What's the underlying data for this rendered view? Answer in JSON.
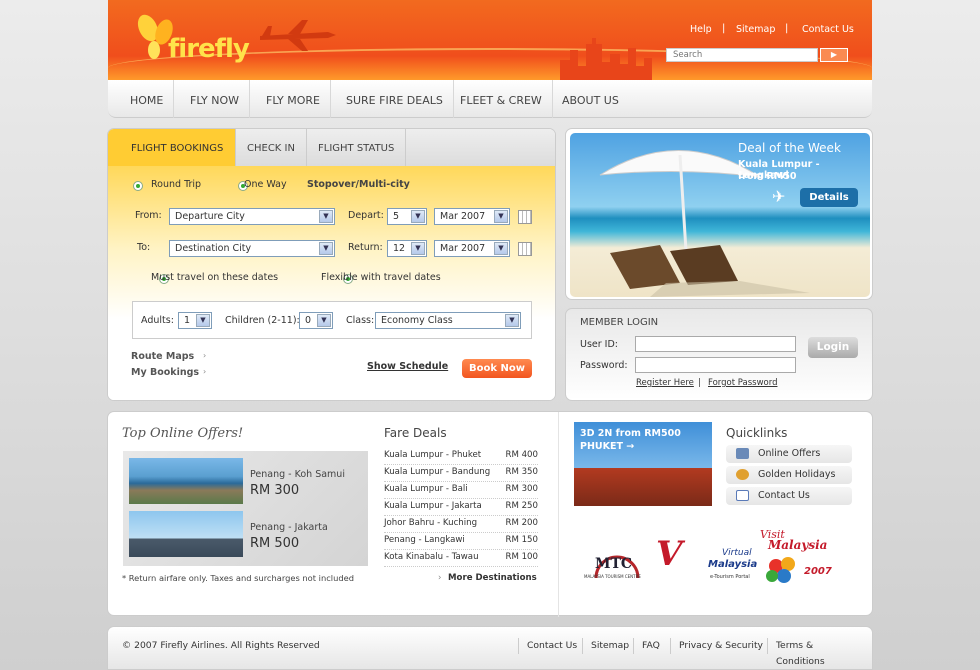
{
  "brand": {
    "name": "firefly"
  },
  "top_links": {
    "help": "Help",
    "sitemap": "Sitemap",
    "contact": "Contact Us"
  },
  "search": {
    "placeholder": "Search"
  },
  "nav": {
    "home": "HOME",
    "fly_now": "FLY NOW",
    "fly_more": "FLY MORE",
    "sure_fire": "SURE FIRE DEALS",
    "fleet": "FLEET & CREW",
    "about": "ABOUT US"
  },
  "booking": {
    "tabs": {
      "bookings": "FLIGHT BOOKINGS",
      "checkin": "CHECK IN",
      "status": "FLIGHT STATUS"
    },
    "trip": {
      "round": "Round Trip",
      "oneway": "One Way",
      "multi": "Stopover/Multi-city"
    },
    "from_label": "From:",
    "from_value": "Departure City",
    "to_label": "To:",
    "to_value": "Destination City",
    "depart_label": "Depart:",
    "depart_day": "5",
    "depart_month": "Mar 2007",
    "return_label": "Return:",
    "return_day": "12",
    "return_month": "Mar 2007",
    "must_travel": "Must travel on these dates",
    "flexible": "Flexible with travel dates",
    "adults_label": "Adults:",
    "adults_value": "1",
    "children_label": "Children (2-11):",
    "children_value": "0",
    "class_label": "Class:",
    "class_value": "Economy Class",
    "route_maps": "Route Maps",
    "my_bookings": "My Bookings",
    "show_schedule": "Show Schedule",
    "book_now": "Book Now"
  },
  "deal": {
    "title": "Deal of the Week",
    "route": "Kuala Lumpur - Langkawi",
    "price": "from RM50",
    "details": "Details"
  },
  "member": {
    "title": "MEMBER LOGIN",
    "userid": "User ID:",
    "password": "Password:",
    "login": "Login",
    "register": "Register Here",
    "sep": "|",
    "forgot": "Forgot Password"
  },
  "offers": {
    "title": "Top Online Offers!",
    "items": [
      {
        "route": "Penang - Koh Samui",
        "price": "RM 300"
      },
      {
        "route": "Penang - Jakarta",
        "price": "RM 500"
      }
    ],
    "note": "* Return airfare only. Taxes and surcharges not included"
  },
  "fares": {
    "title": "Fare Deals",
    "rows": [
      {
        "route": "Kuala Lumpur - Phuket",
        "price": "RM 400"
      },
      {
        "route": "Kuala Lumpur - Bandung",
        "price": "RM 350"
      },
      {
        "route": "Kuala Lumpur - Bali",
        "price": "RM 300"
      },
      {
        "route": "Kuala Lumpur - Jakarta",
        "price": "RM 250"
      },
      {
        "route": "Johor Bahru - Kuching",
        "price": "RM 200"
      },
      {
        "route": "Penang - Langkawi",
        "price": "RM 150"
      },
      {
        "route": "Kota Kinabalu - Tawau",
        "price": "RM 100"
      }
    ],
    "more": "More Destinations"
  },
  "promo": {
    "line1": "3D 2N from RM500",
    "line2": "PHUKET →"
  },
  "quicklinks": {
    "title": "Quicklinks",
    "offers": "Online Offers",
    "holidays": "Golden Holidays",
    "contact": "Contact Us"
  },
  "partners": {
    "mtc": "MTC",
    "mtc_sub": "MALAYSIA TOURISM CENTRE",
    "vm1": "Virtual",
    "vm2": "Malaysia",
    "vm3": "e-Tourism Portal",
    "visit1": "Visit",
    "visit2": "Malaysia",
    "visit_year": "2007"
  },
  "footer": {
    "copyright": "© 2007 Firefly Airlines. All Rights Reserved",
    "contact": "Contact Us",
    "sitemap": "Sitemap",
    "faq": "FAQ",
    "privacy": "Privacy & Security",
    "terms": "Terms & Conditions"
  }
}
